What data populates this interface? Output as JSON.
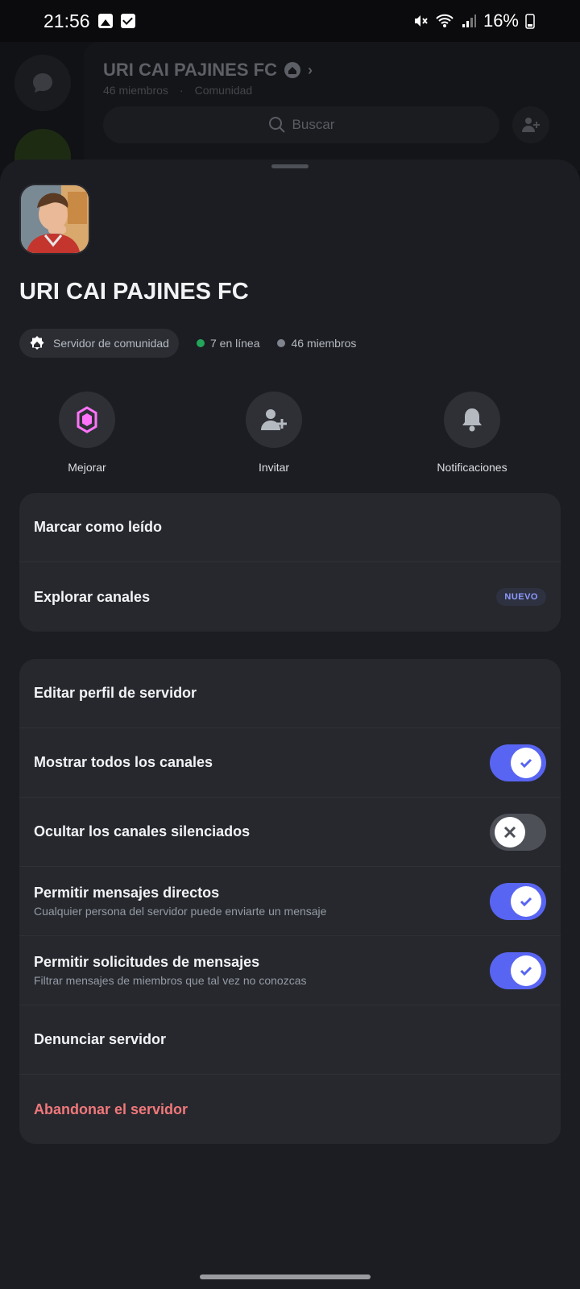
{
  "status_bar": {
    "time": "21:56",
    "battery": "16%"
  },
  "background": {
    "server_title": "URI CAI PAJINES FC",
    "members": "46 miembros",
    "type": "Comunidad",
    "search_placeholder": "Buscar"
  },
  "server": {
    "name": "URI CAI PAJINES FC",
    "community_label": "Servidor de comunidad",
    "online": "7 en línea",
    "members": "46 miembros",
    "online_color": "#23a55a",
    "members_color": "#80848e"
  },
  "actions": [
    {
      "label": "Mejorar",
      "icon": "boost-icon"
    },
    {
      "label": "Invitar",
      "icon": "add-member-icon"
    },
    {
      "label": "Notificaciones",
      "icon": "bell-icon"
    }
  ],
  "group1": {
    "mark_read": "Marcar como leído",
    "browse_channels": "Explorar canales",
    "new_badge": "NUEVO"
  },
  "group2": {
    "edit_profile": "Editar perfil de servidor",
    "show_all": {
      "label": "Mostrar todos los canales",
      "on": true
    },
    "hide_muted": {
      "label": "Ocultar los canales silenciados",
      "on": false
    },
    "allow_dm": {
      "label": "Permitir mensajes directos",
      "desc": "Cualquier persona del servidor puede enviarte un mensaje",
      "on": true
    },
    "allow_requests": {
      "label": "Permitir solicitudes de mensajes",
      "desc": "Filtrar mensajes de miembros que tal vez no conozcas",
      "on": true
    },
    "report": "Denunciar servidor",
    "leave": "Abandonar el servidor"
  },
  "colors": {
    "accent": "#5865f2",
    "danger": "#f0787a",
    "boost": "#ff73fa"
  }
}
